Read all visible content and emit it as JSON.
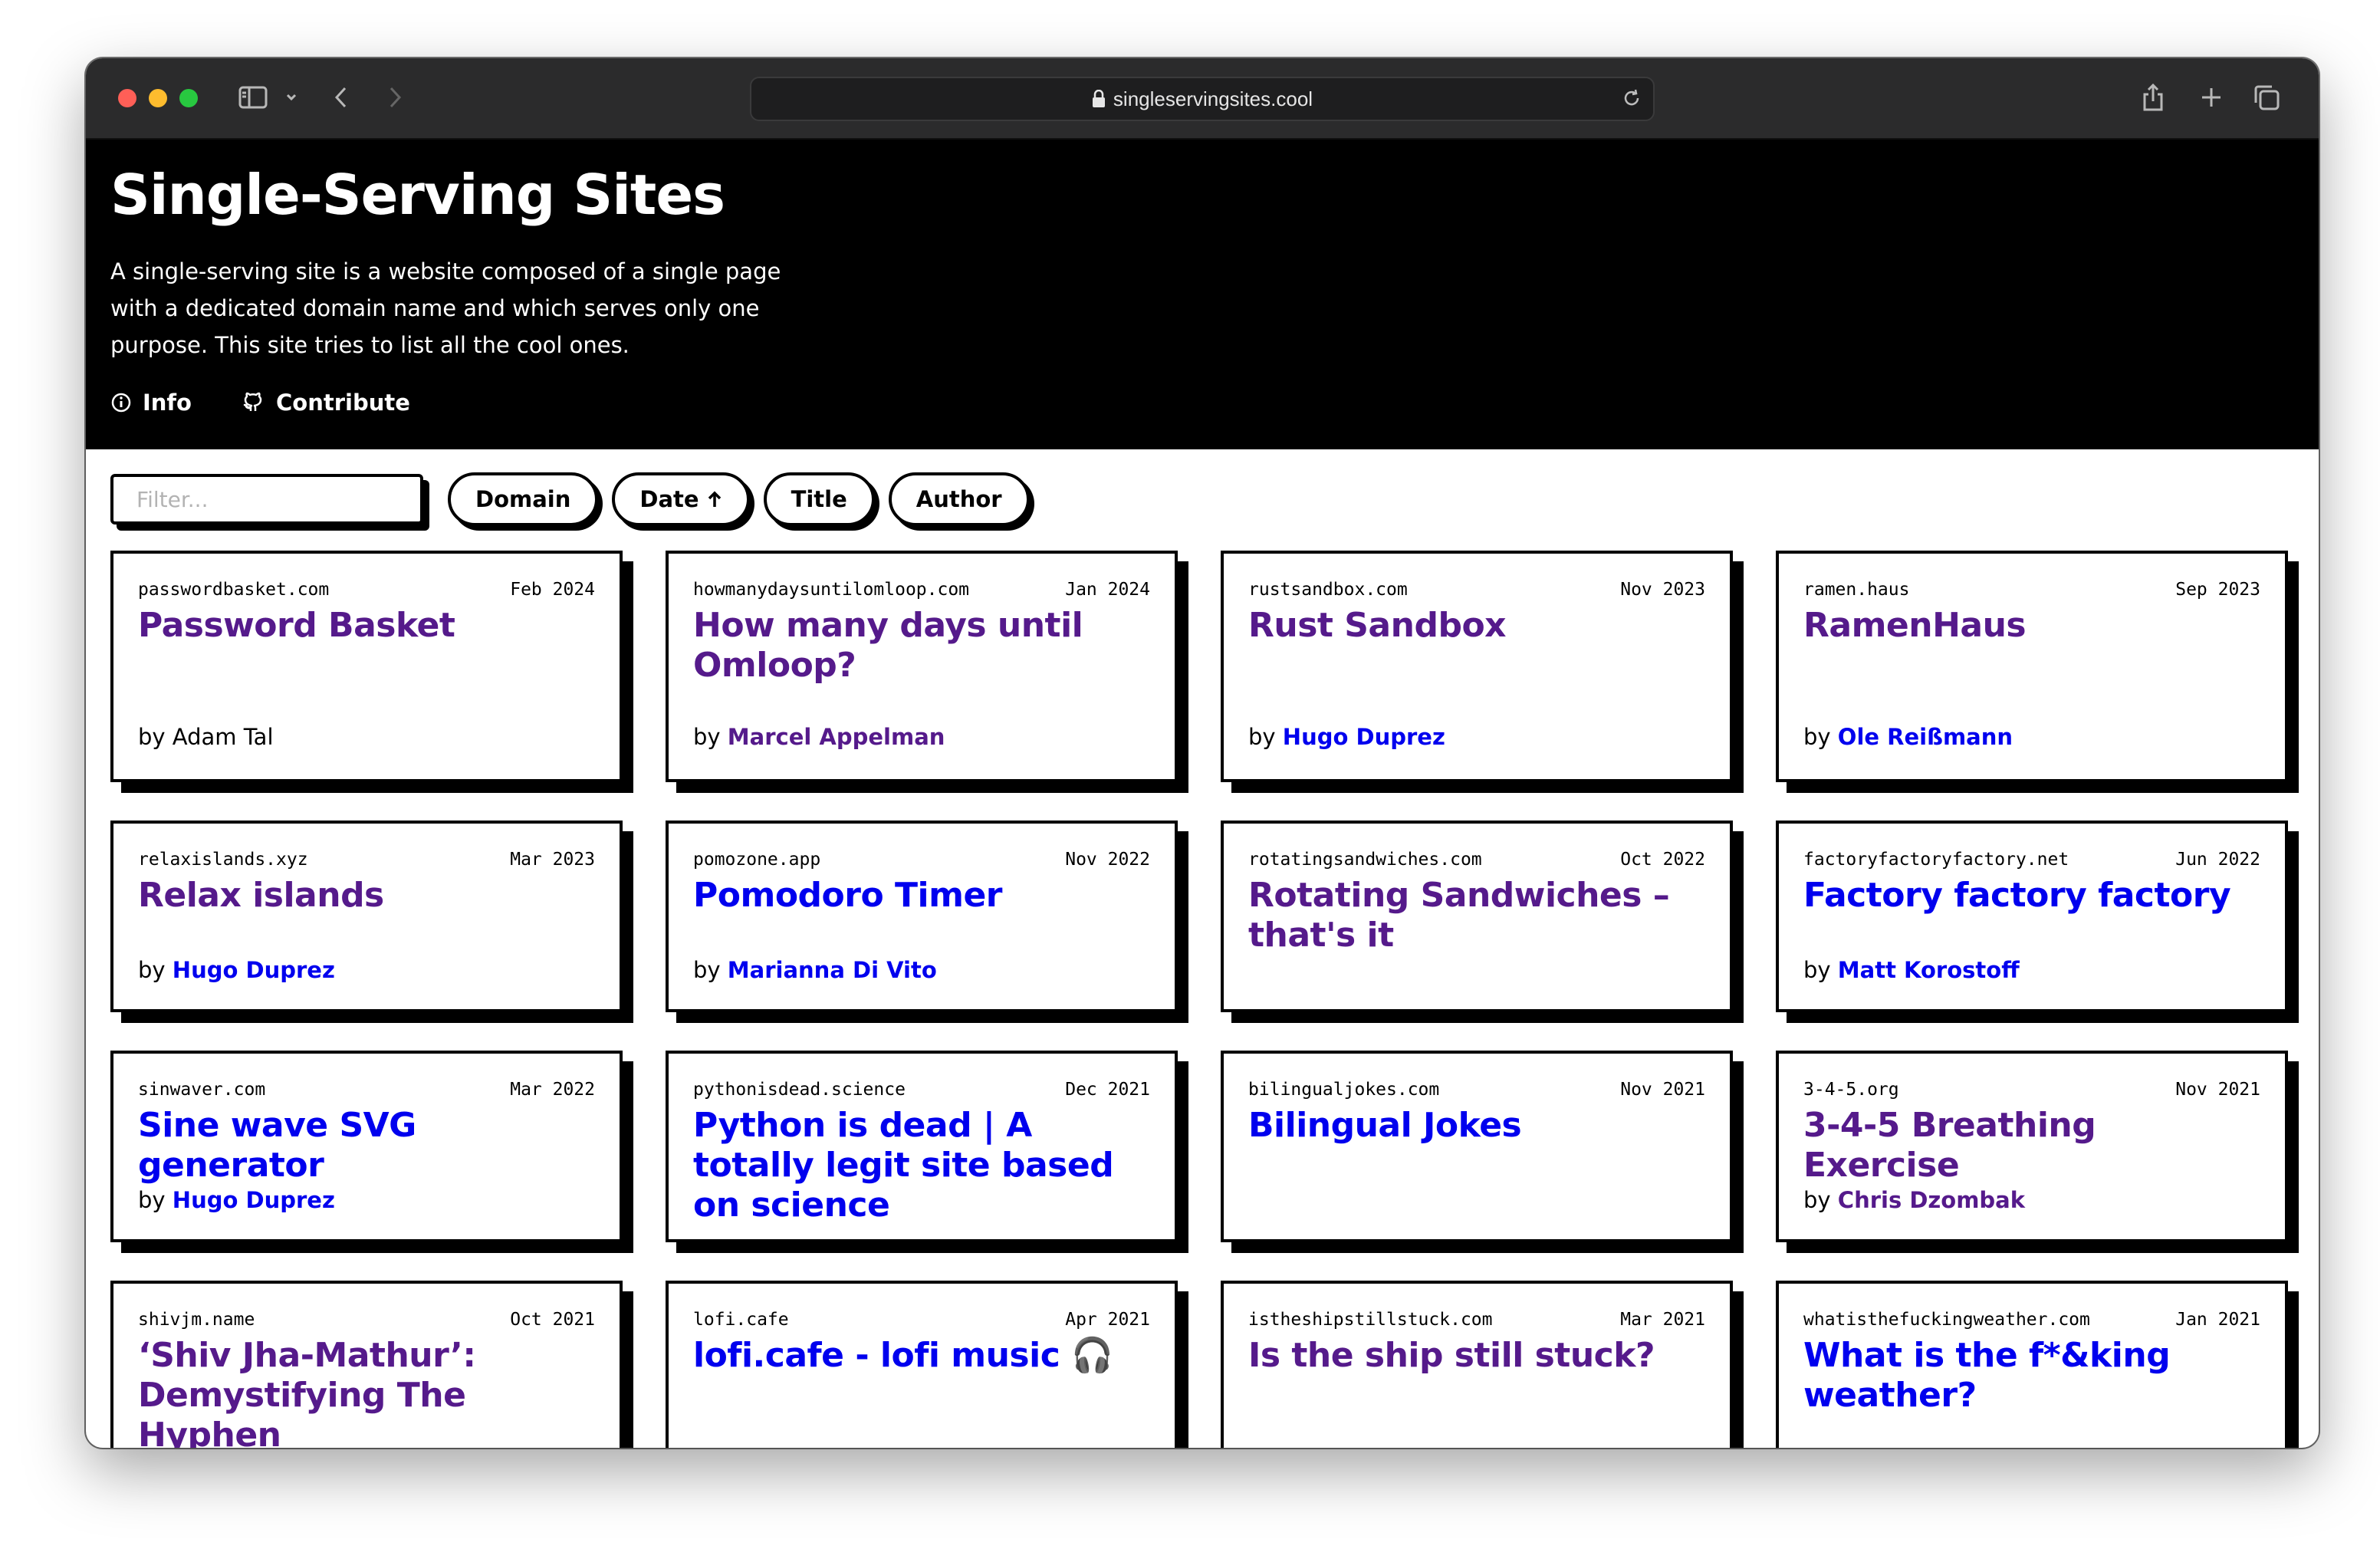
{
  "browser": {
    "url": "singleservingsites.cool"
  },
  "header": {
    "title": "Single-Serving Sites",
    "description": "A single-serving site is a website composed of a single page with a dedicated domain name and which serves only one purpose. This site tries to list all the cool ones.",
    "links": [
      {
        "label": "Info",
        "icon": "info-icon"
      },
      {
        "label": "Contribute",
        "icon": "github-icon"
      }
    ]
  },
  "controls": {
    "filter_placeholder": "Filter...",
    "sort_buttons": [
      "Domain",
      "Date",
      "Title",
      "Author"
    ],
    "active_sort": "Date",
    "sort_direction_icon": "arrow-up-icon"
  },
  "cards": [
    {
      "domain": "passwordbasket.com",
      "date": "Feb 2024",
      "title": "Password Basket",
      "title_state": "visited",
      "author": "Adam Tal",
      "author_state": "plain"
    },
    {
      "domain": "howmanydaysuntilomloop.com",
      "date": "Jan 2024",
      "title": "How many days until Omloop?",
      "title_state": "visited",
      "author": "Marcel Appelman",
      "author_state": "visited"
    },
    {
      "domain": "rustsandbox.com",
      "date": "Nov 2023",
      "title": "Rust Sandbox",
      "title_state": "visited",
      "author": "Hugo Duprez",
      "author_state": "link"
    },
    {
      "domain": "ramen.haus",
      "date": "Sep 2023",
      "title": "RamenHaus",
      "title_state": "visited",
      "author": "Ole Reißmann",
      "author_state": "link"
    },
    {
      "domain": "relaxislands.xyz",
      "date": "Mar 2023",
      "title": "Relax islands",
      "title_state": "visited",
      "author": "Hugo Duprez",
      "author_state": "link"
    },
    {
      "domain": "pomozone.app",
      "date": "Nov 2022",
      "title": "Pomodoro Timer",
      "title_state": "link",
      "author": "Marianna Di Vito",
      "author_state": "link"
    },
    {
      "domain": "rotatingsandwiches.com",
      "date": "Oct 2022",
      "title": "Rotating Sandwiches – that's it",
      "title_state": "visited",
      "author": "",
      "author_state": "none"
    },
    {
      "domain": "factoryfactoryfactory.net",
      "date": "Jun 2022",
      "title": "Factory factory factory",
      "title_state": "link",
      "author": "Matt Korostoff",
      "author_state": "link"
    },
    {
      "domain": "sinwaver.com",
      "date": "Mar 2022",
      "title": "Sine wave SVG generator",
      "title_state": "link",
      "author": "Hugo Duprez",
      "author_state": "link"
    },
    {
      "domain": "pythonisdead.science",
      "date": "Dec 2021",
      "title": "Python is dead | A totally legit site based on science",
      "title_state": "link",
      "author": "",
      "author_state": "none"
    },
    {
      "domain": "bilingualjokes.com",
      "date": "Nov 2021",
      "title": "Bilingual Jokes",
      "title_state": "link",
      "author": "",
      "author_state": "none"
    },
    {
      "domain": "3-4-5.org",
      "date": "Nov 2021",
      "title": "3-4-5 Breathing Exercise",
      "title_state": "visited",
      "author": "Chris Dzombak",
      "author_state": "visited"
    },
    {
      "domain": "shivjm.name",
      "date": "Oct 2021",
      "title": "‘Shiv Jha-Mathur’: Demystifying The Hyphen",
      "title_state": "visited",
      "author": "",
      "author_state": "none"
    },
    {
      "domain": "lofi.cafe",
      "date": "Apr 2021",
      "title": "lofi.cafe - lofi music 🎧",
      "title_state": "link",
      "author": "",
      "author_state": "none"
    },
    {
      "domain": "istheshipstillstuck.com",
      "date": "Mar 2021",
      "title": "Is the ship still stuck?",
      "title_state": "visited",
      "author": "",
      "author_state": "none"
    },
    {
      "domain": "whatisthefuckingweather.com",
      "date": "Jan 2021",
      "title": "What is the f*&king weather?",
      "title_state": "link",
      "author": "",
      "author_state": "none"
    }
  ],
  "by_prefix": "by"
}
